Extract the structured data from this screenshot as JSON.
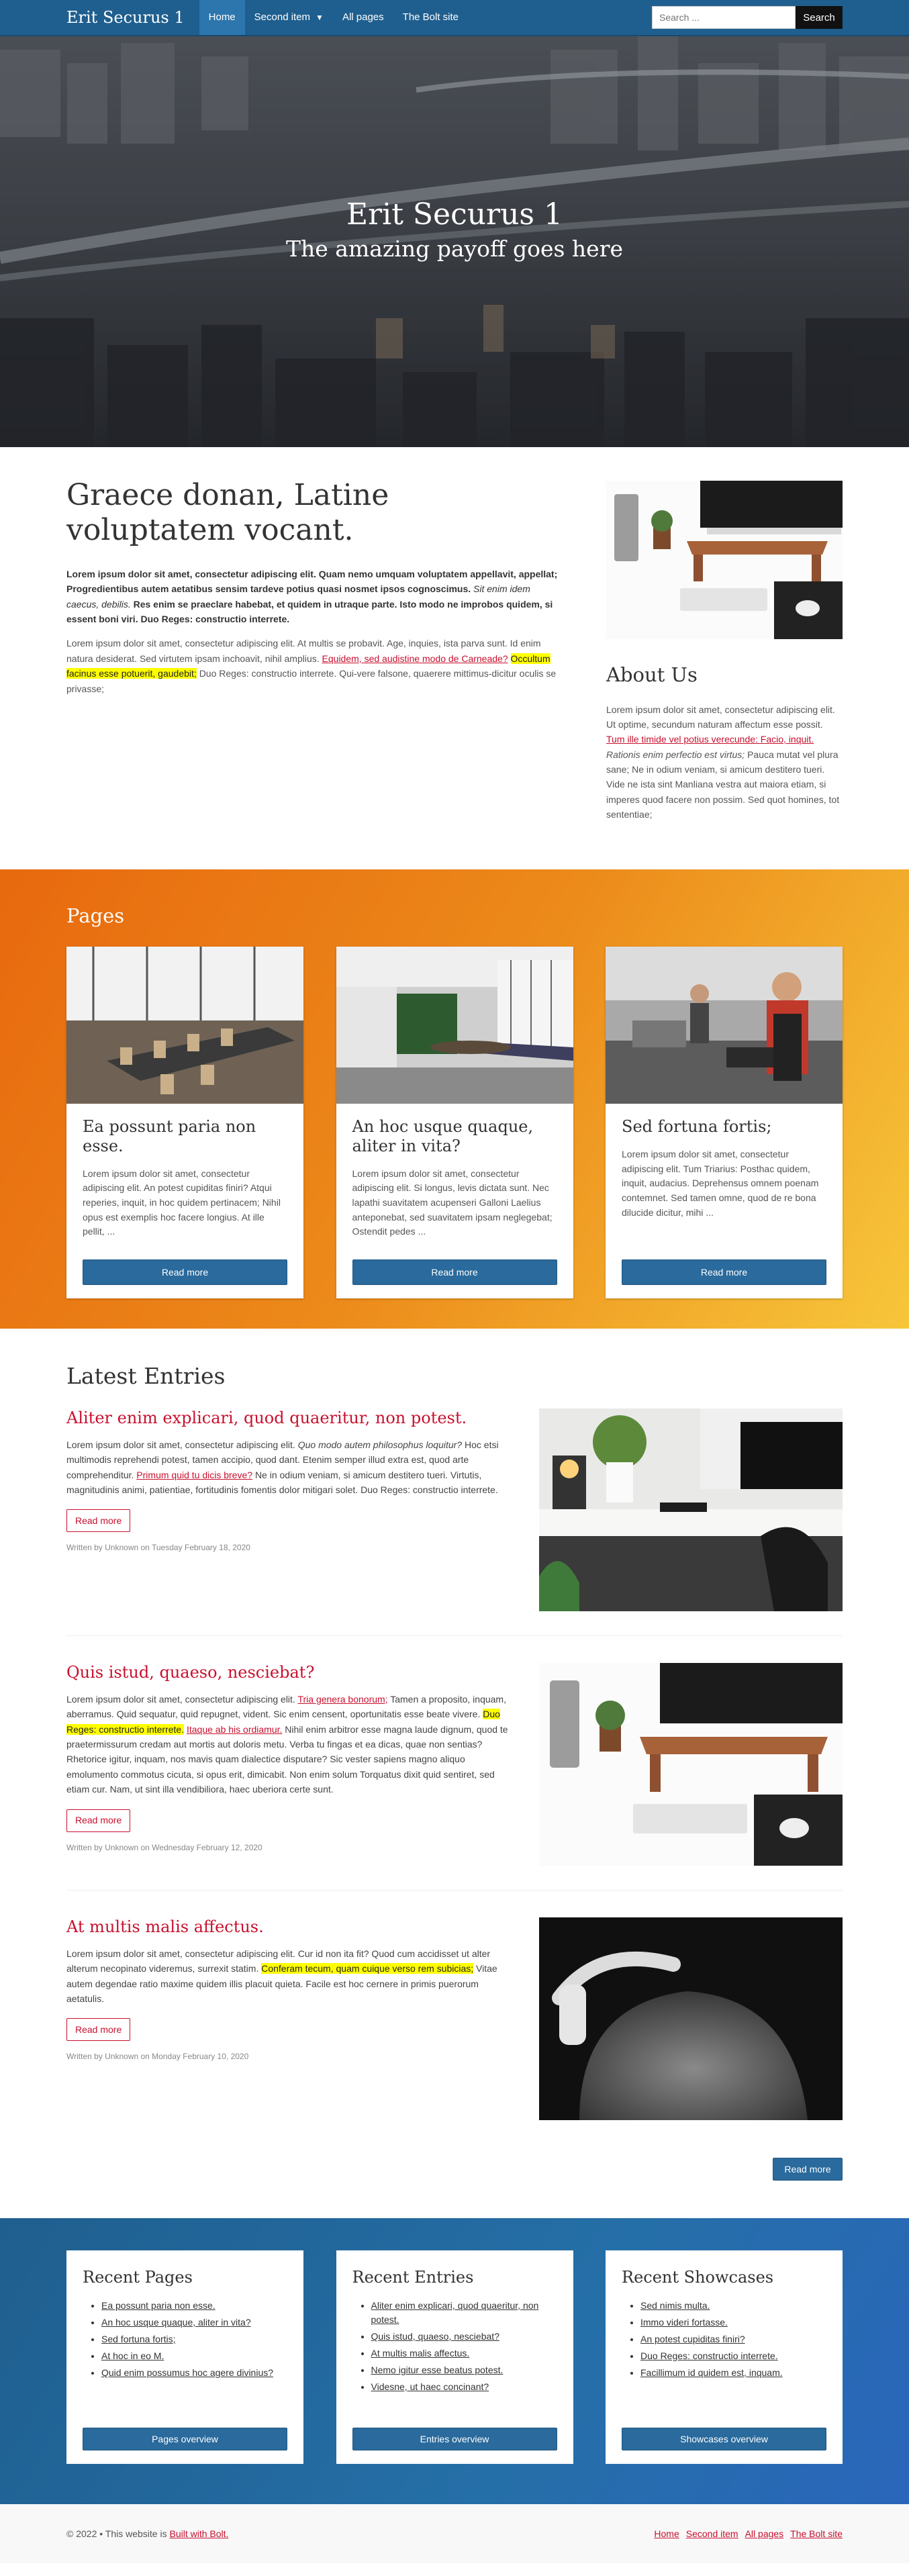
{
  "nav": {
    "brand": "Erit Securus 1",
    "links": [
      "Home",
      "Second item",
      "All pages",
      "The Bolt site"
    ],
    "search_placeholder": "Search ...",
    "search_button": "Search"
  },
  "hero": {
    "title": "Erit Securus 1",
    "subtitle": "The amazing payoff goes here"
  },
  "intro": {
    "heading": "Graece donan, Latine voluptatem vocant.",
    "lead_1": "Lorem ipsum dolor sit amet, consectetur adipiscing elit. Quam nemo umquam voluptatem appellavit, appellat; Progredientibus autem aetatibus sensim tardeve potius quasi nosmet ipsos cognoscimus.",
    "lead_em": "Sit enim idem caecus, debilis.",
    "lead_2": "Res enim se praeclare habebat, et quidem in utraque parte. Isto modo ne improbos quidem, si essent boni viri. Duo Reges: constructio interrete.",
    "para_1": "Lorem ipsum dolor sit amet, consectetur adipiscing elit. At multis se probavit. Age, inquies, ista parva sunt. Id enim natura desiderat. Sed virtutem ipsam inchoavit, nihil amplius.",
    "para_link": "Equidem, sed audistine modo de Carneade?",
    "para_hl": "Occultum facinus esse potuerit, gaudebit;",
    "para_2": "Duo Reges: constructio interrete. Qui-vere falsone, quaerere mittimus-dicitur oculis se privasse;"
  },
  "about": {
    "heading": "About Us",
    "text_1": "Lorem ipsum dolor sit amet, consectetur adipiscing elit. Ut optime, secundum naturam affectum esse possit.",
    "link": "Tum ille timide vel potius verecunde: Facio, inquit.",
    "em": "Rationis enim perfectio est virtus;",
    "text_2": "Pauca mutat vel plura sane; Ne in odium veniam, si amicum destitero tueri. Vide ne ista sint Manliana vestra aut maiora etiam, si imperes quod facere non possim. Sed quot homines, tot sententiae;"
  },
  "pages": {
    "heading": "Pages",
    "button": "Read more",
    "cards": [
      {
        "title": "Ea possunt paria non esse.",
        "text": "Lorem ipsum dolor sit amet, consectetur adipiscing elit. An potest cupiditas finiri? Atqui reperies, inquit, in hoc quidem pertinacem; Nihil opus est exemplis hoc facere longius. At ille pellit, ..."
      },
      {
        "title": "An hoc usque quaque, aliter in vita?",
        "text": "Lorem ipsum dolor sit amet, consectetur adipiscing elit. Si longus, levis dictata sunt. Nec lapathi suavitatem acupenseri Galloni Laelius anteponebat, sed suavitatem ipsam neglegebat; Ostendit pedes ..."
      },
      {
        "title": "Sed fortuna fortis;",
        "text": "Lorem ipsum dolor sit amet, consectetur adipiscing elit. Tum Triarius: Posthac quidem, inquit, audacius. Deprehensus omnem poenam contemnet. Sed tamen omne, quod de re bona dilucide dicitur, mihi ..."
      }
    ]
  },
  "latest": {
    "heading": "Latest Entries",
    "read_more": "Read more",
    "more_button": "Read more",
    "entries": [
      {
        "title": "Aliter enim explicari, quod quaeritur, non potest.",
        "t1": "Lorem ipsum dolor sit amet, consectetur adipiscing elit.",
        "em": "Quo modo autem philosophus loquitur?",
        "t2": "Hoc etsi multimodis reprehendi potest, tamen accipio, quod dant. Etenim semper illud extra est, quod arte comprehenditur.",
        "link": "Primum quid tu dicis breve?",
        "t3": "Ne in odium veniam, si amicum destitero tueri. Virtutis, magnitudinis animi, patientiae, fortitudinis fomentis dolor mitigari solet. Duo Reges: constructio interrete.",
        "meta": "Written by Unknown on Tuesday February 18, 2020"
      },
      {
        "title": "Quis istud, quaeso, nesciebat?",
        "t1": "Lorem ipsum dolor sit amet, consectetur adipiscing elit.",
        "link": "Tria genera bonorum;",
        "t2": "Tamen a proposito, inquam, aberramus. Quid sequatur, quid repugnet, vident. Sic enim censent, oportunitatis esse beate vivere.",
        "hl": "Duo Reges: constructio interrete.",
        "link2": "Itaque ab his ordiamur.",
        "t3": "Nihil enim arbitror esse magna laude dignum, quod te praetermissurum credam aut mortis aut doloris metu. Verba tu fingas et ea dicas, quae non sentias? Rhetorice igitur, inquam, nos mavis quam dialectice disputare? Sic vester sapiens magno aliquo emolumento commotus cicuta, si opus erit, dimicabit. Non enim solum Torquatus dixit quid sentiret, sed etiam cur. Nam, ut sint illa vendibiliora, haec uberiora certe sunt.",
        "meta": "Written by Unknown on Wednesday February 12, 2020"
      },
      {
        "title": "At multis malis affectus.",
        "t1": "Lorem ipsum dolor sit amet, consectetur adipiscing elit. Cur id non ita fit? Quod cum accidisset ut alter alterum necopinato videremus, surrexit statim.",
        "hl": "Conferam tecum, quam cuique verso rem subicias;",
        "t2": "Vitae autem degendae ratio maxime quidem illis placuit quieta. Facile est hoc cernere in primis puerorum aetatulis.",
        "meta": "Written by Unknown on Monday February 10, 2020"
      }
    ]
  },
  "recent": [
    {
      "title": "Recent Pages",
      "items": [
        "Ea possunt paria non esse.",
        "An hoc usque quaque, aliter in vita?",
        "Sed fortuna fortis;",
        "At hoc in eo M.",
        "Quid enim possumus hoc agere divinius?"
      ],
      "button": "Pages overview"
    },
    {
      "title": "Recent Entries",
      "items": [
        "Aliter enim explicari, quod quaeritur, non potest.",
        "Quis istud, quaeso, nesciebat?",
        "At multis malis affectus.",
        "Nemo igitur esse beatus potest.",
        "Videsne, ut haec concinant?"
      ],
      "button": "Entries overview"
    },
    {
      "title": "Recent Showcases",
      "items": [
        "Sed nimis multa.",
        "Immo videri fortasse.",
        "An potest cupiditas finiri?",
        "Duo Reges: constructio interrete.",
        "Facillimum id quidem est, inquam."
      ],
      "button": "Showcases overview"
    }
  ],
  "footer": {
    "copyright": "© 2022 • This website is",
    "bolt_link": "Built with Bolt.",
    "links": [
      "Home",
      "Second item",
      "All pages",
      "The Bolt site"
    ]
  },
  "colors": {
    "nav": "#1f5f8f",
    "accent_red": "#c8102e",
    "button_blue": "#2a6a9c",
    "orange": "#ec8a1a",
    "highlight": "#ffff00"
  }
}
